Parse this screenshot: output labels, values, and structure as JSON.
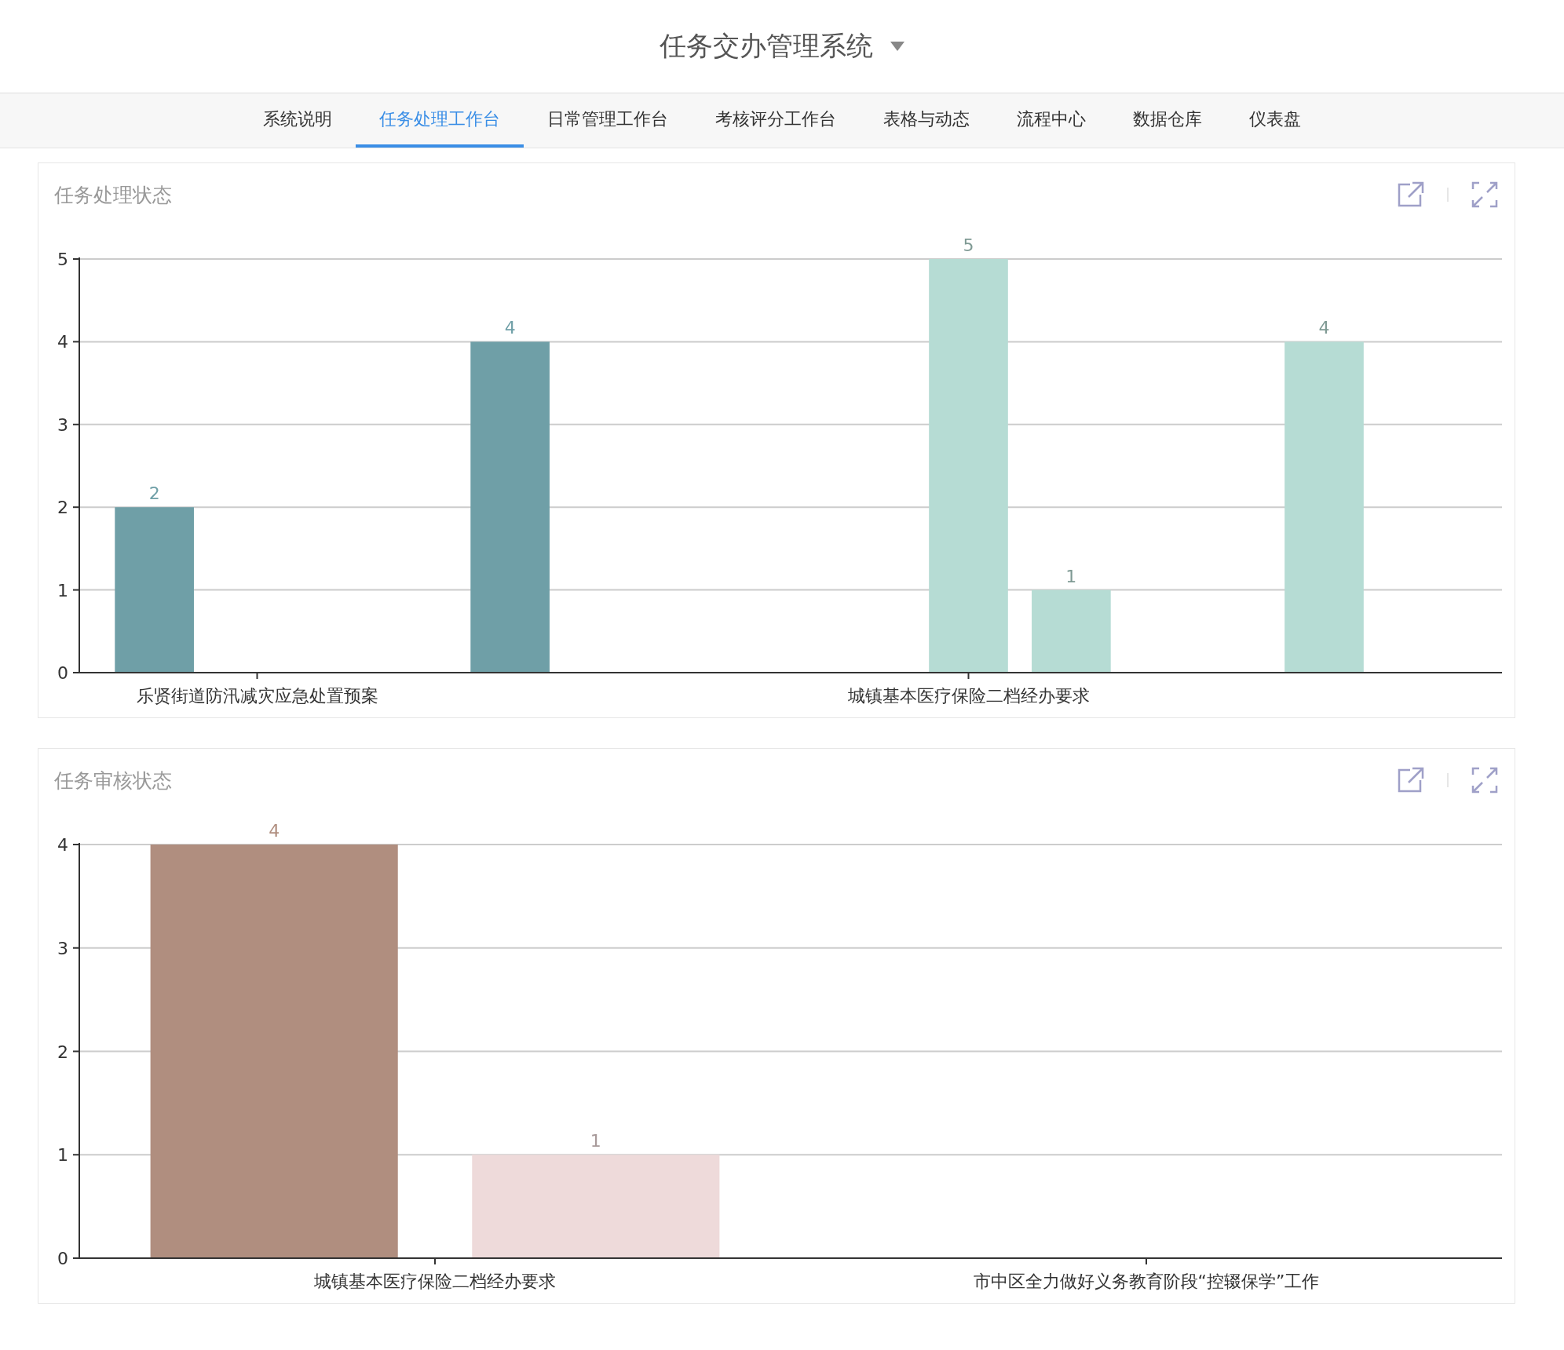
{
  "header": {
    "title": "任务交办管理系统"
  },
  "tabs": [
    {
      "label": "系统说明",
      "selected": false
    },
    {
      "label": "任务处理工作台",
      "selected": true
    },
    {
      "label": "日常管理工作台",
      "selected": false
    },
    {
      "label": "考核评分工作台",
      "selected": false
    },
    {
      "label": "表格与动态",
      "selected": false
    },
    {
      "label": "流程中心",
      "selected": false
    },
    {
      "label": "数据仓库",
      "selected": false
    },
    {
      "label": "仪表盘",
      "selected": false
    }
  ],
  "panels": [
    {
      "title": "任务处理状态",
      "chart_data": {
        "type": "bar",
        "categories": [
          "乐贤街道防汛减灾应急处置预案",
          null,
          "城镇基本医疗保险二档经办要求",
          null
        ],
        "series": [
          {
            "color": "#6f9fa7",
            "values": [
              2,
              4,
              null,
              null
            ]
          },
          {
            "color": "#b6dcd4",
            "values": [
              null,
              null,
              5,
              4
            ]
          },
          {
            "color": "#b6dcd4",
            "values": [
              null,
              null,
              1,
              null
            ]
          }
        ],
        "ylim": [
          0,
          5
        ],
        "grid": true,
        "yticks": [
          0,
          1,
          2,
          3,
          4,
          5
        ],
        "data_labels": true
      }
    },
    {
      "title": "任务审核状态",
      "chart_data": {
        "type": "bar",
        "categories": [
          "城镇基本医疗保险二档经办要求",
          "市中区全力做好义务教育阶段“控辍保学”工作"
        ],
        "series": [
          {
            "color": "#b08e7f",
            "values": [
              4,
              null
            ]
          },
          {
            "color": "#eedada",
            "values": [
              1,
              null
            ]
          }
        ],
        "ylim": [
          0,
          4
        ],
        "grid": true,
        "yticks": [
          0,
          1,
          2,
          3,
          4
        ],
        "data_labels": true
      }
    }
  ]
}
